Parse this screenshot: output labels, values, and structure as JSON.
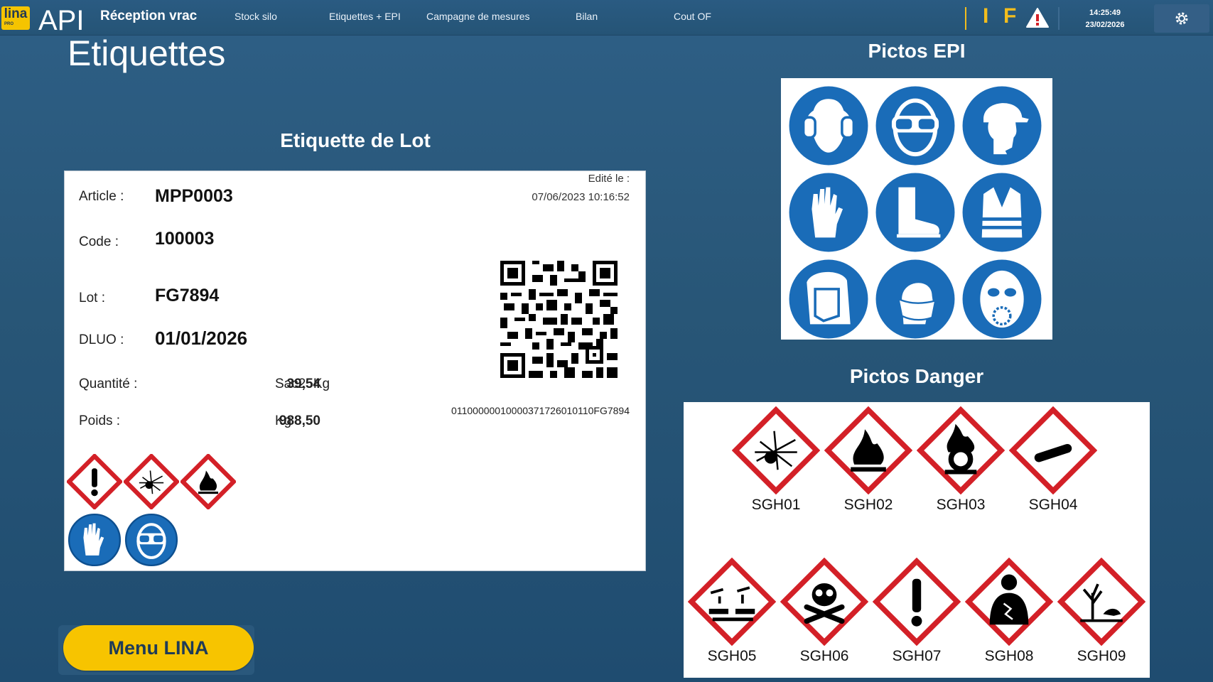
{
  "header": {
    "app_title": "Réception vrac",
    "nav": [
      "Stock silo",
      "Etiquettes + EPI",
      "Campagne de mesures",
      "Bilan",
      "Cout OF"
    ],
    "indicator_i": "I",
    "indicator_f": "F",
    "time": "14:25:49",
    "date": "23/02/2026",
    "logo_text": "lina",
    "logo_sub": "PRO",
    "logo_api": "API"
  },
  "page": {
    "title": "Etiquettes",
    "lot_heading": "Etiquette de Lot",
    "epi_heading": "Pictos EPI",
    "danger_heading": "Pictos Danger"
  },
  "label": {
    "edited_caption": "Edité le :",
    "edited_date": "07/06/2023 10:16:52",
    "article_label": "Article :",
    "article_value": "MPP0003",
    "code_label": "Code :",
    "code_value": "100003",
    "lot_label": "Lot :",
    "lot_value": "FG7894",
    "dluo_label": "DLUO :",
    "dluo_value": "01/01/2026",
    "qty_label": "Quantité :",
    "qty_value": "39,54",
    "qty_unit": "Sac25Kg",
    "weight_label": "Poids :",
    "weight_value": "988,50",
    "weight_unit": "Kg",
    "barcode_text": "01100000010000371726010110FG7894",
    "danger_icons": [
      "exclamation-icon",
      "explosive-icon",
      "flame-icon"
    ],
    "epi_icons": [
      "gloves-icon",
      "goggles-icon"
    ]
  },
  "epi_icons": [
    "ear-protection-icon",
    "goggles-icon",
    "helmet-icon",
    "gloves-icon",
    "safety-boots-icon",
    "hi-vis-vest-icon",
    "face-shield-icon",
    "dust-mask-icon",
    "respirator-icon"
  ],
  "danger_pictos": [
    "SGH01",
    "SGH02",
    "SGH03",
    "SGH04",
    "SGH05",
    "SGH06",
    "SGH07",
    "SGH08",
    "SGH09"
  ],
  "menu_button": "Menu LINA",
  "colors": {
    "accent": "#f7c400",
    "epi_blue": "#1a6cb8",
    "danger_red": "#d32027",
    "background": "#285677"
  }
}
